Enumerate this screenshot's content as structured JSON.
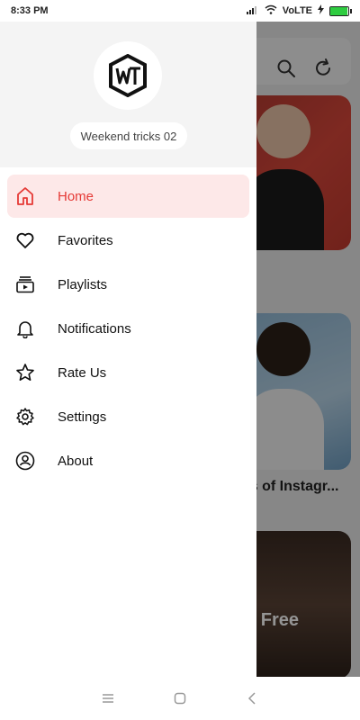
{
  "status_bar": {
    "time": "8:33 PM",
    "network": "VoLTE",
    "battery_level": 0.95
  },
  "drawer": {
    "channel_name": "Weekend tricks 02",
    "items": [
      {
        "label": "Home",
        "icon": "home-icon",
        "active": true
      },
      {
        "label": "Favorites",
        "icon": "heart-icon",
        "active": false
      },
      {
        "label": "Playlists",
        "icon": "playlist-icon",
        "active": false
      },
      {
        "label": "Notifications",
        "icon": "bell-icon",
        "active": false
      },
      {
        "label": "Rate Us",
        "icon": "star-icon",
        "active": false
      },
      {
        "label": "Settings",
        "icon": "gear-icon",
        "active": false
      },
      {
        "label": "About",
        "icon": "user-circle-icon",
        "active": false
      }
    ]
  },
  "background": {
    "caption_fragment": "ns of Instagr...",
    "overlay_fragment": "es Free"
  },
  "colors": {
    "accent": "#e53935",
    "active_bg": "#fde8e8",
    "header_bg": "#f4f4f4"
  }
}
